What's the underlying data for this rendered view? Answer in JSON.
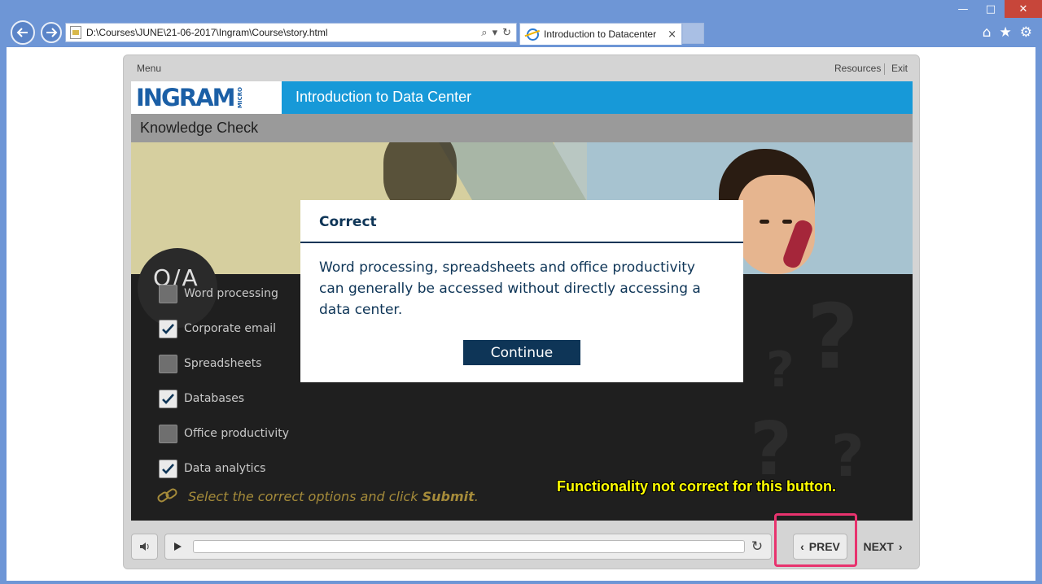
{
  "browser": {
    "address_url": "D:\\Courses\\JUNE\\21-06-2017\\Ingram\\Course\\story.html",
    "tab_title": "Introduction to Datacenter",
    "tab_close": "×",
    "icons": [
      "back-arrow-icon",
      "forward-arrow-icon",
      "search-icon",
      "refresh-icon",
      "home-icon",
      "favorites-star-icon",
      "settings-gear-icon"
    ],
    "window_controls": {
      "minimize": "—",
      "maximize": "□",
      "close": "✕"
    }
  },
  "player": {
    "menu_label": "Menu",
    "resources_label": "Resources",
    "exit_label": "Exit",
    "logo": "INGRAM",
    "logo_sub": "MICRO",
    "course_title": "Introduction to Data Center",
    "section_title": "Knowledge Check",
    "qa_badge": "Q/A",
    "options": [
      {
        "label": "Word processing",
        "checked": false
      },
      {
        "label": "Corporate email",
        "checked": true
      },
      {
        "label": "Spreadsheets",
        "checked": false
      },
      {
        "label": "Databases",
        "checked": true
      },
      {
        "label": "Office productivity",
        "checked": false
      },
      {
        "label": "Data analytics",
        "checked": true
      }
    ],
    "instruction_prefix": "Select the correct options and click ",
    "instruction_bold": "Submit",
    "instruction_suffix": ".",
    "annotation": "Functionality not correct for this button.",
    "controls": {
      "prev_label": "PREV",
      "next_label": "NEXT"
    }
  },
  "modal": {
    "title": "Correct",
    "body": "Word processing, spreadsheets and office productivity can generally be accessed without directly accessing a data center.",
    "button_label": "Continue"
  },
  "colors": {
    "header_blue": "#1799d8",
    "modal_navy": "#0e3557",
    "annotation_yellow": "#ffff00",
    "highlight_pink": "#e8336e",
    "browser_frame": "#6e96d6"
  }
}
